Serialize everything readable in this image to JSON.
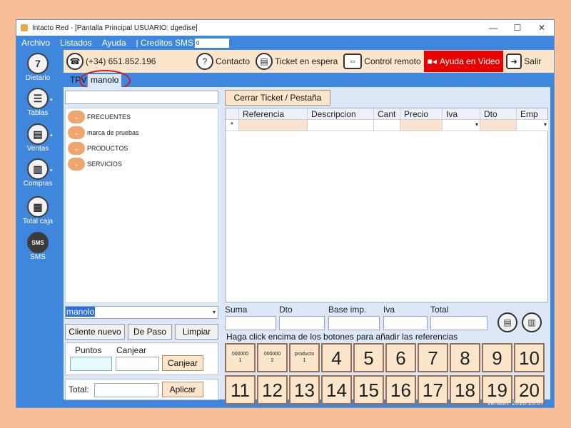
{
  "window": {
    "title": "Intacto Red - [Pantalla Principal USUARIO: dgedise]",
    "controls": [
      "—",
      "☐",
      "✕"
    ]
  },
  "menu": {
    "items": [
      "Archivo",
      "Listados",
      "Ayuda",
      "| Creditos SMS"
    ],
    "sms_value": "0"
  },
  "sidebar": {
    "items": [
      {
        "label": "Dietario",
        "icon": "calendar-icon",
        "glyph": "7"
      },
      {
        "label": "Tablas",
        "icon": "list-icon",
        "glyph": "☰"
      },
      {
        "label": "Ventas",
        "icon": "document-icon",
        "glyph": "▤"
      },
      {
        "label": "Compras",
        "icon": "clipboard-icon",
        "glyph": "▥"
      },
      {
        "label": "Total caja",
        "icon": "calculator-icon",
        "glyph": "▦"
      },
      {
        "label": "SMS",
        "icon": "sms-icon",
        "glyph": "SMS"
      }
    ]
  },
  "toolbar": {
    "phone": "(+34) 651.852.196",
    "contacto": "Contacto",
    "ticket": "Ticket en espera",
    "control": "Control remoto",
    "ayuda_video": "Ayuda en Video",
    "salir": "Salir"
  },
  "tabs": {
    "tpv": "TPV",
    "active": "manolo"
  },
  "tree": {
    "items": [
      "FRECUENTES",
      "marca de pruebas",
      "PRODUCTOS",
      "SERVICIOS"
    ]
  },
  "client": {
    "value": "manolo",
    "nuevo": "Cliente nuevo",
    "de_paso": "De Paso",
    "limpiar": "Limpiar"
  },
  "puntos": {
    "puntos_label": "Puntos",
    "canjear_label": "Canjear",
    "canjear_button": "Canjear"
  },
  "total": {
    "label": "Total:",
    "aplicar": "Aplicar"
  },
  "cerrar_ticket": "Cerrar Ticket / Pestaña",
  "grid": {
    "columns": [
      "Referencia",
      "Descripcion",
      "Cant",
      "Precio",
      "Iva",
      "Dto",
      "Emp"
    ],
    "row_marker": "*"
  },
  "summary": {
    "suma": "Suma",
    "dto": "Dto",
    "base": "Base imp.",
    "iva": "Iva",
    "total": "Total"
  },
  "hint": "Haga click encima de los botones para añadir las referencias",
  "keys": {
    "row1": [
      {
        "label": "000000\n1",
        "small": true
      },
      {
        "label": "000000\n2",
        "small": true
      },
      {
        "label": "producto\n1",
        "small": true
      },
      {
        "label": "4"
      },
      {
        "label": "5"
      },
      {
        "label": "6"
      },
      {
        "label": "7"
      },
      {
        "label": "8"
      },
      {
        "label": "9"
      },
      {
        "label": "10"
      }
    ],
    "row2": [
      {
        "label": "11"
      },
      {
        "label": "12"
      },
      {
        "label": "13"
      },
      {
        "label": "14"
      },
      {
        "label": "15"
      },
      {
        "label": "16"
      },
      {
        "label": "17"
      },
      {
        "label": "18"
      },
      {
        "label": "19"
      },
      {
        "label": "20"
      }
    ]
  },
  "version": "Version: 2016.10.07"
}
